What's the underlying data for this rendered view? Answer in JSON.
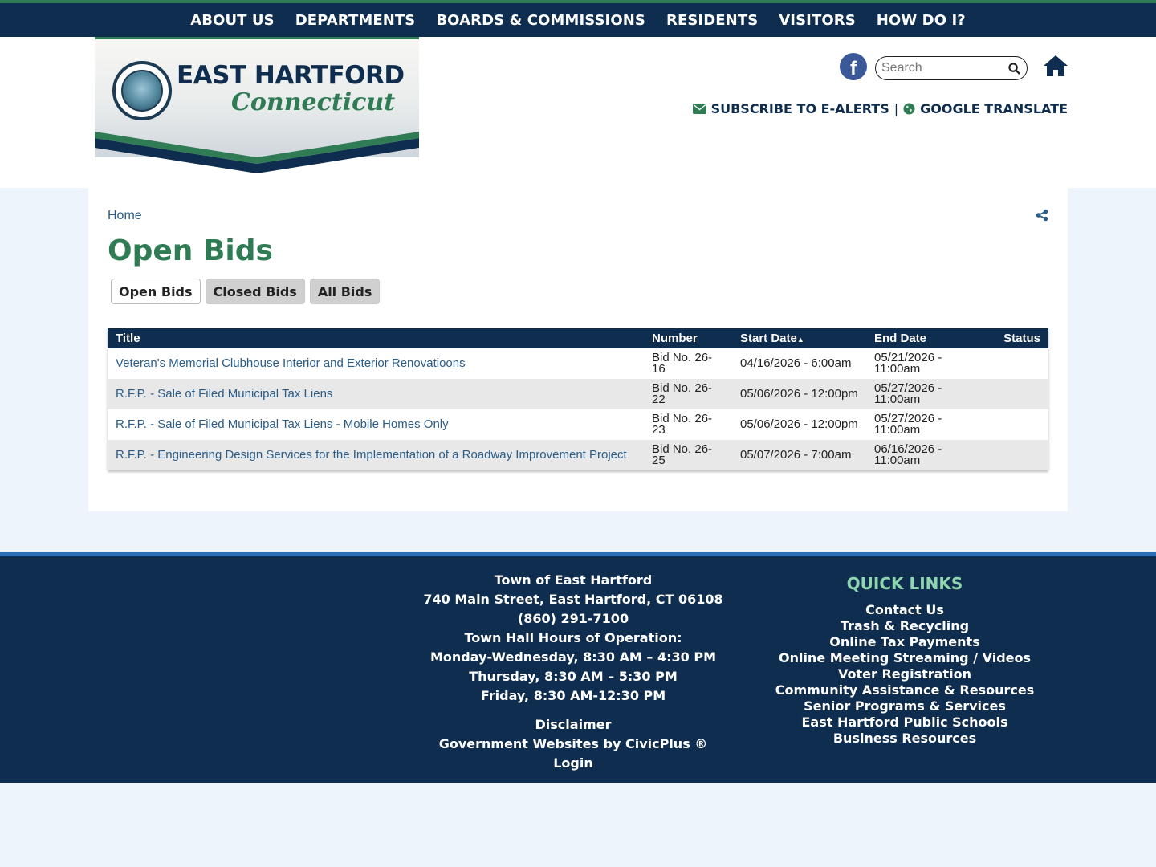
{
  "topnav": {
    "items": [
      "ABOUT US",
      "DEPARTMENTS",
      "BOARDS & COMMISSIONS",
      "RESIDENTS",
      "VISITORS",
      "HOW DO I?"
    ]
  },
  "logo": {
    "title": "EAST HARTFORD",
    "subtitle": "Connecticut"
  },
  "header": {
    "facebook_icon": "f",
    "search_placeholder": "Search",
    "subscribe_label": "SUBSCRIBE TO E-ALERTS",
    "separator": "|",
    "translate_label": "GOOGLE TRANSLATE"
  },
  "breadcrumb": {
    "home": "Home"
  },
  "page": {
    "title": "Open Bids",
    "tabs": [
      "Open Bids",
      "Closed Bids",
      "All Bids"
    ]
  },
  "table": {
    "columns": {
      "title": "Title",
      "number": "Number",
      "start": "Start Date",
      "start_sort": "▲",
      "end": "End Date",
      "status": "Status"
    },
    "rows": [
      {
        "title": "Veteran's Memorial Clubhouse Interior and Exterior Renovatioons",
        "number": "Bid No. 26-16",
        "start": "04/16/2026 - 6:00am",
        "end": "05/21/2026 - 11:00am",
        "status": ""
      },
      {
        "title": "R.F.P. - Sale of Filed Municipal Tax Liens",
        "number": "Bid No. 26-22",
        "start": "05/06/2026 - 12:00pm",
        "end": "05/27/2026 - 11:00am",
        "status": ""
      },
      {
        "title": "R.F.P. - Sale of Filed Municipal Tax Liens - Mobile Homes Only",
        "number": "Bid No. 26-23",
        "start": "05/06/2026 - 12:00pm",
        "end": "05/27/2026 - 11:00am",
        "status": ""
      },
      {
        "title": "R.F.P. - Engineering Design Services for the Implementation of a Roadway Improvement Project",
        "number": "Bid No. 26-25",
        "start": "05/07/2026 - 7:00am",
        "end": "06/16/2026 - 11:00am",
        "status": ""
      }
    ]
  },
  "footer": {
    "town": "Town of East Hartford",
    "address": "740 Main Street, East Hartford, CT 06108  (860) 291-7100",
    "hours_title": "Town Hall Hours of Operation:",
    "hours_1": "Monday-Wednesday, 8:30 AM – 4:30 PM",
    "hours_2": "Thursday, 8:30 AM – 5:30 PM",
    "hours_3": "Friday, 8:30 AM-12:30 PM",
    "disclaimer": "Disclaimer",
    "civicplus": "Government Websites by CivicPlus ®",
    "login": "Login"
  },
  "quick_links": {
    "title": "QUICK LINKS",
    "items": [
      "Contact Us",
      "Trash & Recycling",
      "Online Tax Payments",
      "Online Meeting Streaming / Videos",
      "Voter Registration",
      "Community Assistance & Resources",
      "Senior Programs & Services",
      "East Hartford Public Schools",
      "Business Resources"
    ]
  },
  "colors": {
    "navy": "#0f2e4f",
    "green": "#2f7b54",
    "link_blue": "#2a5d8a",
    "footer_accent": "#2a6fb4",
    "quick_links_title": "#8fd6b0"
  }
}
